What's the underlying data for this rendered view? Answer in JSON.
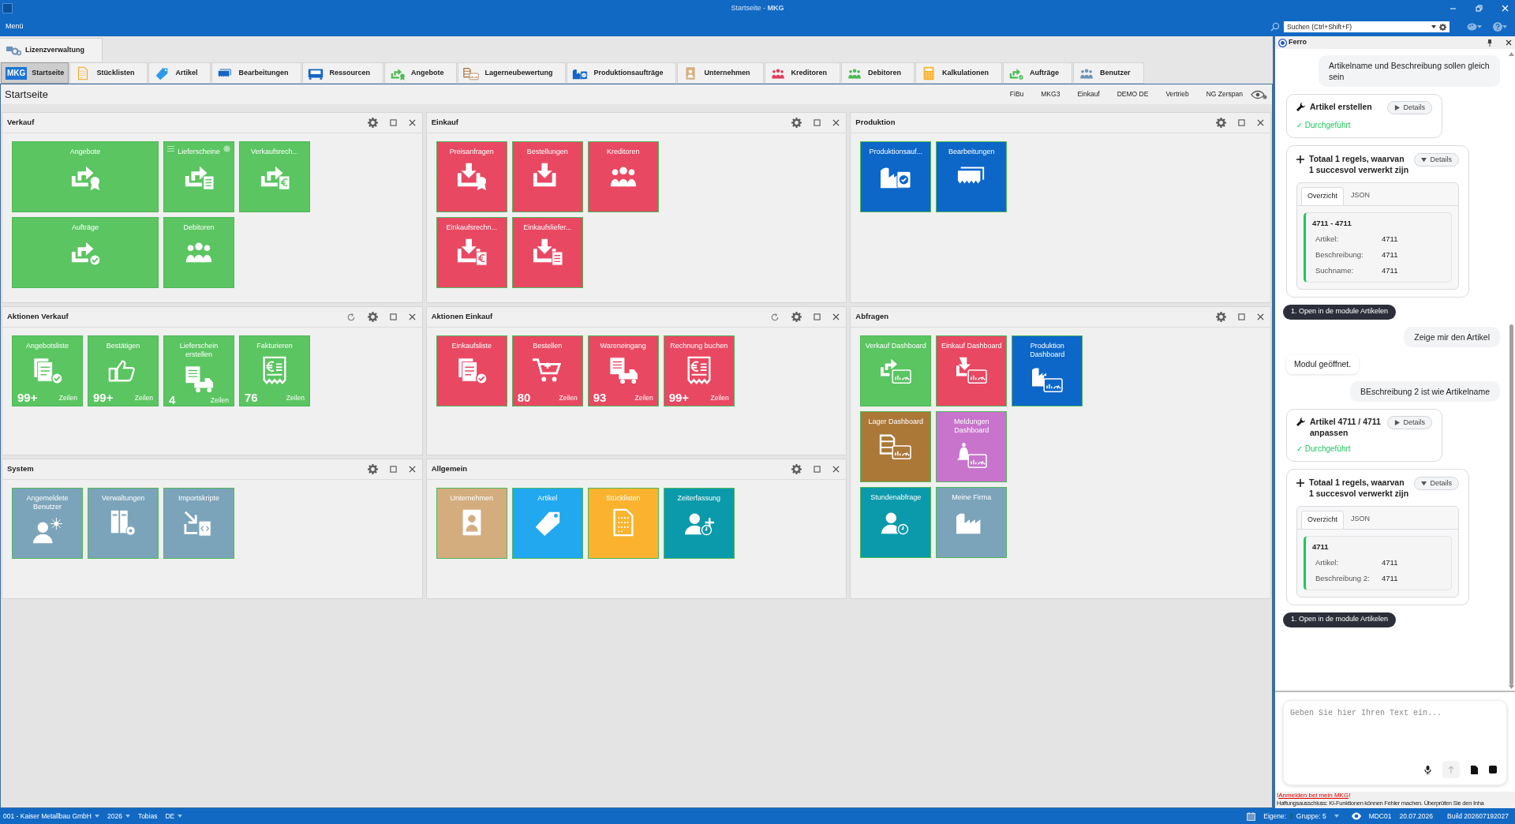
{
  "window": {
    "title": "Startseite - **MKG**"
  },
  "menu": {
    "label": "Menü"
  },
  "search": {
    "placeholder": "Suchen (Ctrl+Shift+F)"
  },
  "top_tabs": [
    {
      "label": "Lizenzverwaltung",
      "selected": true
    }
  ],
  "module_tabs": [
    {
      "label": "Startseite",
      "logo": "MKG",
      "selected": true
    },
    {
      "label": "Stücklisten",
      "selected": false
    },
    {
      "label": "Artikel",
      "selected": false
    },
    {
      "label": "Bearbeitungen",
      "selected": false
    },
    {
      "label": "Ressourcen",
      "selected": false
    },
    {
      "label": "Angebote",
      "selected": false
    },
    {
      "label": "Lagerneubewertung",
      "selected": false
    },
    {
      "label": "Produktionsaufträge",
      "selected": false
    },
    {
      "label": "Unternehmen",
      "selected": false
    },
    {
      "label": "Kreditoren",
      "selected": false
    },
    {
      "label": "Debitoren",
      "selected": false
    },
    {
      "label": "Kalkulationen",
      "selected": false
    },
    {
      "label": "Aufträge",
      "selected": false
    },
    {
      "label": "Benutzer",
      "selected": false
    }
  ],
  "page": {
    "title": "Startseite",
    "links": [
      "FiBu",
      "MKG3",
      "Einkauf",
      "DEMO DE",
      "Vertrieb",
      "NG Zerspan"
    ]
  },
  "dashboard": {
    "columns": [
      {
        "panels": [
          {
            "title": "Verkauf",
            "refresh": false,
            "rows": [
              [
                {
                  "kind": "wide",
                  "label": "Angebote",
                  "color": "#5ac561",
                  "hovered": false
                },
                {
                  "kind": "square",
                  "label": "Lieferscheine",
                  "color": "#5ac561",
                  "hovered": true
                },
                {
                  "kind": "square",
                  "label": "Verkaufsrech...",
                  "color": "#5ac561",
                  "hovered": false
                }
              ],
              [
                {
                  "kind": "wide",
                  "label": "Aufträge",
                  "color": "#5ac561",
                  "hovered": false
                },
                {
                  "kind": "square",
                  "label": "Debitoren",
                  "color": "#5ac561",
                  "hovered": false
                }
              ]
            ]
          },
          {
            "title": "Aktionen Verkauf",
            "refresh": true,
            "rows": [
              [
                {
                  "kind": "counter",
                  "label": "Angebotsliste",
                  "count": "99+",
                  "unit": "Zeilen",
                  "color": "#5ac561",
                  "hovered": false
                },
                {
                  "kind": "counter",
                  "label": "Bestätigen",
                  "count": "99+",
                  "unit": "Zeilen",
                  "color": "#5ac561",
                  "hovered": false
                },
                {
                  "kind": "counter",
                  "label": "Lieferschein erstellen",
                  "count": "4",
                  "unit": "Zeilen",
                  "color": "#5ac561",
                  "hovered": false
                },
                {
                  "kind": "counter",
                  "label": "Fakturieren",
                  "count": "76",
                  "unit": "Zeilen",
                  "color": "#5ac561",
                  "hovered": false
                }
              ]
            ]
          },
          {
            "title": "System",
            "refresh": false,
            "rows": [
              [
                {
                  "kind": "square",
                  "label": "Angemeldete Benutzer",
                  "color": "#7ba4ba",
                  "hovered": false
                },
                {
                  "kind": "square",
                  "label": "Verwaltungen",
                  "color": "#7ba4ba",
                  "hovered": false
                },
                {
                  "kind": "square",
                  "label": "Importskripte",
                  "color": "#7ba4ba",
                  "hovered": false
                }
              ]
            ]
          }
        ]
      },
      {
        "panels": [
          {
            "title": "Einkauf",
            "refresh": false,
            "rows": [
              [
                {
                  "kind": "square",
                  "label": "Preisanfragen",
                  "color": "#e94862",
                  "hovered": false
                },
                {
                  "kind": "square",
                  "label": "Bestellungen",
                  "color": "#e94862",
                  "hovered": false
                },
                {
                  "kind": "square",
                  "label": "Kreditoren",
                  "color": "#e94862",
                  "hovered": false
                }
              ],
              [
                {
                  "kind": "square",
                  "label": "Einkaufsrechn...",
                  "color": "#e94862",
                  "hovered": false
                },
                {
                  "kind": "square",
                  "label": "Einkaufsliefer...",
                  "color": "#e94862",
                  "hovered": false
                }
              ]
            ]
          },
          {
            "title": "Aktionen Einkauf",
            "refresh": true,
            "rows": [
              [
                {
                  "kind": "square",
                  "label": "Einkaufsliste",
                  "color": "#e94862",
                  "hovered": false
                },
                {
                  "kind": "counter",
                  "label": "Bestellen",
                  "count": "80",
                  "unit": "Zeilen",
                  "color": "#e94862",
                  "hovered": false
                },
                {
                  "kind": "counter",
                  "label": "Wareneingang",
                  "count": "93",
                  "unit": "Zeilen",
                  "color": "#e94862",
                  "hovered": false
                },
                {
                  "kind": "counter",
                  "label": "Rechnung buchen",
                  "count": "99+",
                  "unit": "Zeilen",
                  "color": "#e94862",
                  "hovered": false
                }
              ]
            ]
          },
          {
            "title": "Allgemein",
            "refresh": false,
            "rows": [
              [
                {
                  "kind": "square",
                  "label": "Unternehmen",
                  "color": "#d4ad7f",
                  "hovered": false
                },
                {
                  "kind": "square",
                  "label": "Artikel",
                  "color": "#21a8ef",
                  "hovered": false
                },
                {
                  "kind": "square",
                  "label": "Stücklisten",
                  "color": "#fbb32f",
                  "hovered": false
                },
                {
                  "kind": "square",
                  "label": "Zeiterfassung",
                  "color": "#0b9aab",
                  "hovered": false
                }
              ]
            ]
          }
        ]
      },
      {
        "panels": [
          {
            "title": "Produktion",
            "refresh": false,
            "rows": [
              [
                {
                  "kind": "square",
                  "label": "Produktionsauf...",
                  "color": "#0d67c9",
                  "hovered": false
                },
                {
                  "kind": "square",
                  "label": "Bearbeitungen",
                  "color": "#0d67c9",
                  "hovered": false
                }
              ]
            ]
          },
          {
            "title": "Abfragen",
            "refresh": false,
            "rows": [
              [
                {
                  "kind": "square",
                  "label": "Verkauf Dashboard",
                  "color": "#5ac561",
                  "hovered": false
                },
                {
                  "kind": "square",
                  "label": "Einkauf Dashboard",
                  "color": "#e94862",
                  "hovered": false
                },
                {
                  "kind": "square",
                  "label": "Produktion Dashboard",
                  "color": "#0d67c9",
                  "hovered": false
                }
              ],
              [
                {
                  "kind": "square",
                  "label": "Lager Dashboard",
                  "color": "#ab7838",
                  "hovered": false
                },
                {
                  "kind": "square",
                  "label": "Meldungen Dashboard",
                  "color": "#c874cc",
                  "hovered": false
                }
              ],
              [
                {
                  "kind": "square",
                  "label": "Stundenabfrage",
                  "color": "#0b9aab",
                  "hovered": false
                },
                {
                  "kind": "square",
                  "label": "Meine Firma",
                  "color": "#7ba4ba",
                  "hovered": false
                }
              ]
            ]
          }
        ]
      }
    ]
  },
  "assistant": {
    "title": "Ferro",
    "messages": [
      {
        "kind": "user",
        "text": "Artikelname und Beschreibung sollen gleich sein"
      },
      {
        "kind": "action",
        "title": "Artikel erstellen",
        "details": "Details",
        "expanded": false,
        "status": "✓ Durchgeführt"
      },
      {
        "kind": "result",
        "title": "Totaal 1 regels, waarvan 1 succesvol verwerkt zijn",
        "details": "Details",
        "expanded": true,
        "tabs": [
          {
            "label": "Overzicht",
            "selected": true
          },
          {
            "label": "JSON",
            "selected": false
          }
        ],
        "heading": "4711 - 4711",
        "fields": [
          {
            "label": "Artikel:",
            "value": "4711"
          },
          {
            "label": "Beschreibung:",
            "value": "4711"
          },
          {
            "label": "Suchname:",
            "value": "4711"
          }
        ]
      },
      {
        "kind": "chip",
        "text": "1. Open in de module Artikelen"
      },
      {
        "kind": "user",
        "text": "Zeige mir den Artikel"
      },
      {
        "kind": "bot",
        "text": "Modul geöffnet."
      },
      {
        "kind": "user",
        "text": "BEschreibung 2 ist wie Artikelname"
      },
      {
        "kind": "action",
        "title": "Artikel 4711 / 4711 anpassen",
        "details": "Details",
        "expanded": false,
        "status": "✓ Durchgeführt"
      },
      {
        "kind": "result",
        "title": "Totaal 1 regels, waarvan 1 succesvol verwerkt zijn",
        "details": "Details",
        "expanded": true,
        "tabs": [
          {
            "label": "Overzicht",
            "selected": true
          },
          {
            "label": "JSON",
            "selected": false
          }
        ],
        "heading": "4711",
        "fields": [
          {
            "label": "Artikel:",
            "value": "4711"
          },
          {
            "label": "Beschreibung 2:",
            "value": "4711"
          }
        ]
      },
      {
        "kind": "chip",
        "text": "1. Open in de module Artikelen"
      }
    ],
    "input": {
      "placeholder": "Geben Sie hier Ihren Text ein..."
    },
    "login": {
      "prefix": "!",
      "link": "Anmelden bei mein MKG",
      "suffix": "!"
    },
    "disclaimer": "Haftungsausschluss: KI-Funktionen können Fehler machen. Überprüfen Sie den Inha"
  },
  "status_bar": {
    "left": [
      {
        "text": "001 - Kaiser Metallbau GmbH",
        "dropdown": true
      },
      {
        "text": "2026",
        "dropdown": true
      },
      {
        "text": "Tobias",
        "dropdown": false
      },
      {
        "text": "DE",
        "dropdown": true
      }
    ],
    "own_label": "Eigene:",
    "own_count": "3",
    "group": "Gruppe: 5",
    "server": "MDC01",
    "date": "20.07.2026",
    "build": "Build 202607192027"
  }
}
